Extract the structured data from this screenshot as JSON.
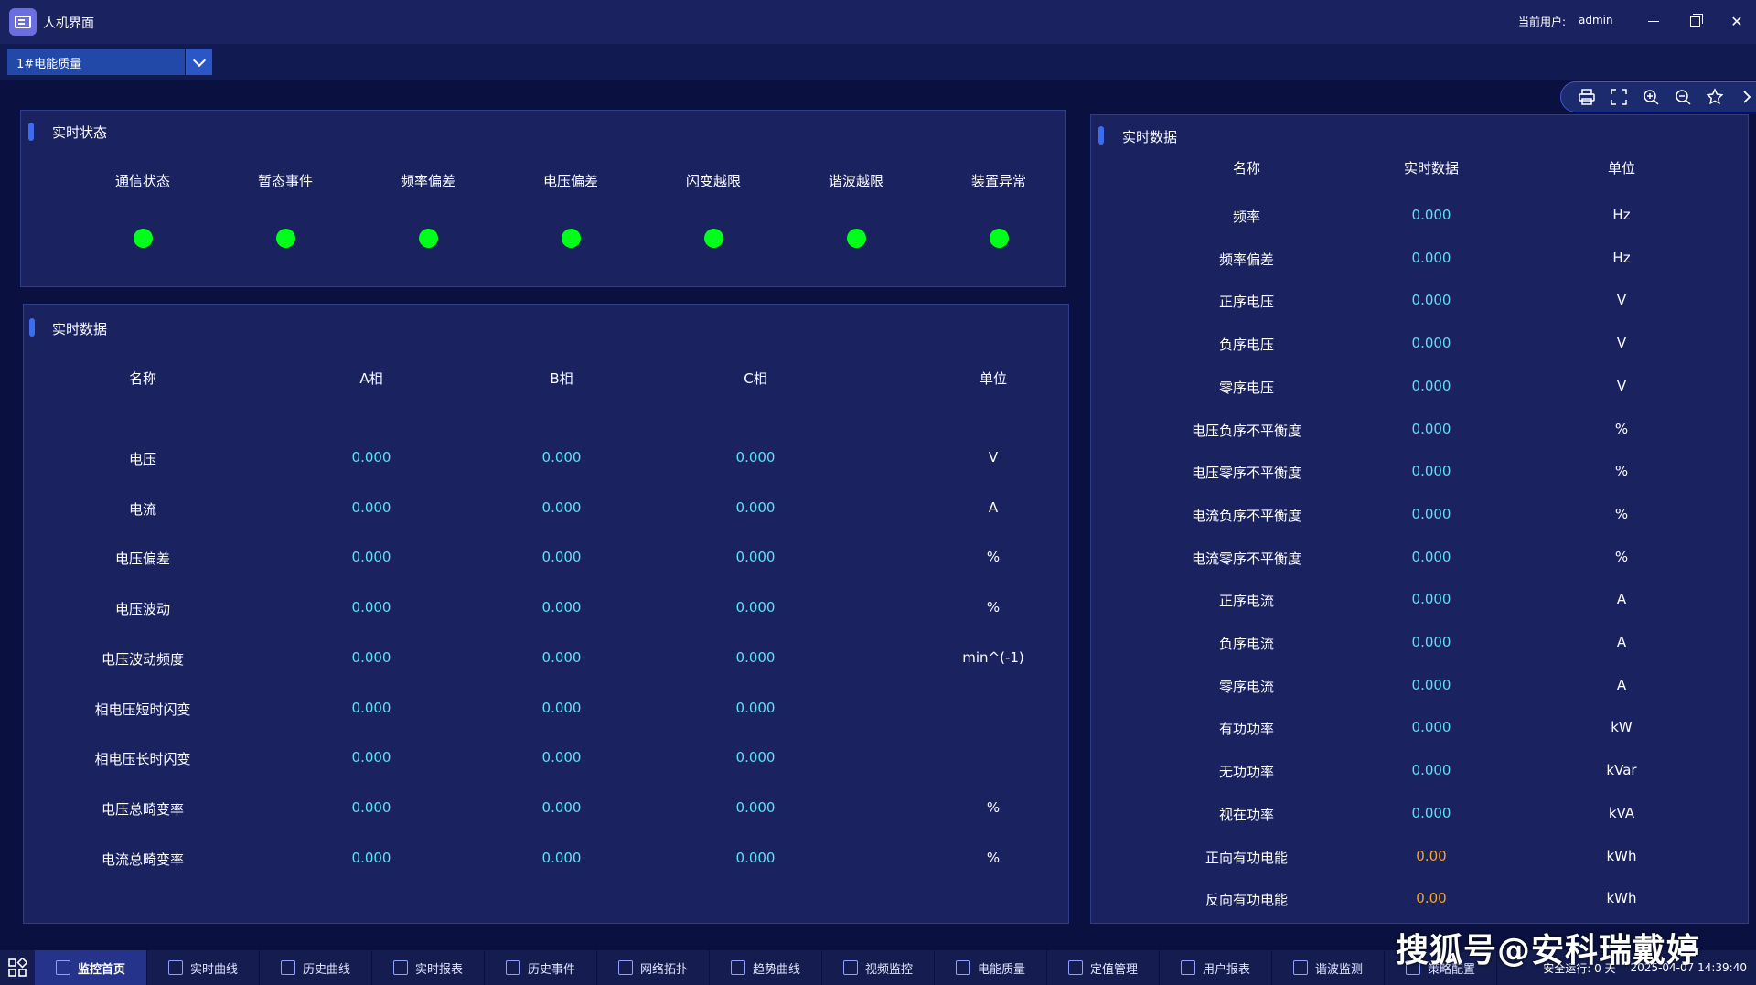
{
  "window": {
    "title": "人机界面",
    "user_label": "当前用户:",
    "user_name": "admin"
  },
  "device_select": {
    "value": "1#电能质量"
  },
  "status_panel": {
    "title": "实时状态",
    "items": [
      {
        "label": "通信状态",
        "color": "#00ff1a"
      },
      {
        "label": "暂态事件",
        "color": "#00ff1a"
      },
      {
        "label": "频率偏差",
        "color": "#00ff1a"
      },
      {
        "label": "电压偏差",
        "color": "#00ff1a"
      },
      {
        "label": "闪变越限",
        "color": "#00ff1a"
      },
      {
        "label": "谐波越限",
        "color": "#00ff1a"
      },
      {
        "label": "装置异常",
        "color": "#00ff1a"
      }
    ]
  },
  "phase_table": {
    "title": "实时数据",
    "headers": [
      "名称",
      "A相",
      "B相",
      "C相",
      "单位"
    ],
    "rows": [
      [
        "电压",
        "0.000",
        "0.000",
        "0.000",
        "V"
      ],
      [
        "电流",
        "0.000",
        "0.000",
        "0.000",
        "A"
      ],
      [
        "电压偏差",
        "0.000",
        "0.000",
        "0.000",
        "%"
      ],
      [
        "电压波动",
        "0.000",
        "0.000",
        "0.000",
        "%"
      ],
      [
        "电压波动频度",
        "0.000",
        "0.000",
        "0.000",
        "min^(-1)"
      ],
      [
        "相电压短时闪变",
        "0.000",
        "0.000",
        "0.000",
        ""
      ],
      [
        "相电压长时闪变",
        "0.000",
        "0.000",
        "0.000",
        ""
      ],
      [
        "电压总畸变率",
        "0.000",
        "0.000",
        "0.000",
        "%"
      ],
      [
        "电流总畸变率",
        "0.000",
        "0.000",
        "0.000",
        "%"
      ]
    ]
  },
  "total_table": {
    "title": "实时数据",
    "headers": [
      "名称",
      "实时数据",
      "单位"
    ],
    "rows": [
      [
        "频率",
        "0.000",
        "Hz"
      ],
      [
        "频率偏差",
        "0.000",
        "Hz"
      ],
      [
        "正序电压",
        "0.000",
        "V"
      ],
      [
        "负序电压",
        "0.000",
        "V"
      ],
      [
        "零序电压",
        "0.000",
        "V"
      ],
      [
        "电压负序不平衡度",
        "0.000",
        "%"
      ],
      [
        "电压零序不平衡度",
        "0.000",
        "%"
      ],
      [
        "电流负序不平衡度",
        "0.000",
        "%"
      ],
      [
        "电流零序不平衡度",
        "0.000",
        "%"
      ],
      [
        "正序电流",
        "0.000",
        "A"
      ],
      [
        "负序电流",
        "0.000",
        "A"
      ],
      [
        "零序电流",
        "0.000",
        "A"
      ],
      [
        "有功功率",
        "0.000",
        "kW"
      ],
      [
        "无功功率",
        "0.000",
        "kVar"
      ],
      [
        "视在功率",
        "0.000",
        "kVA"
      ],
      [
        "正向有功电能",
        "0.00",
        "kWh"
      ],
      [
        "反向有功电能",
        "0.00",
        "kWh"
      ]
    ]
  },
  "taskbar": {
    "items": [
      "监控首页",
      "实时曲线",
      "历史曲线",
      "实时报表",
      "历史事件",
      "网络拓扑",
      "趋势曲线",
      "视频监控",
      "电能质量",
      "定值管理",
      "用户报表",
      "谐波监测",
      "策略配置"
    ],
    "run_status": "安全运行: 0 天",
    "datetime": "2025-04-07 14:39:40"
  },
  "watermark": "搜狐号@安科瑞戴婷",
  "colors": {
    "accent": "#3c6cf0",
    "ok": "#00ff1a",
    "value": "#5ee0f0",
    "energy": "#f5a623"
  }
}
